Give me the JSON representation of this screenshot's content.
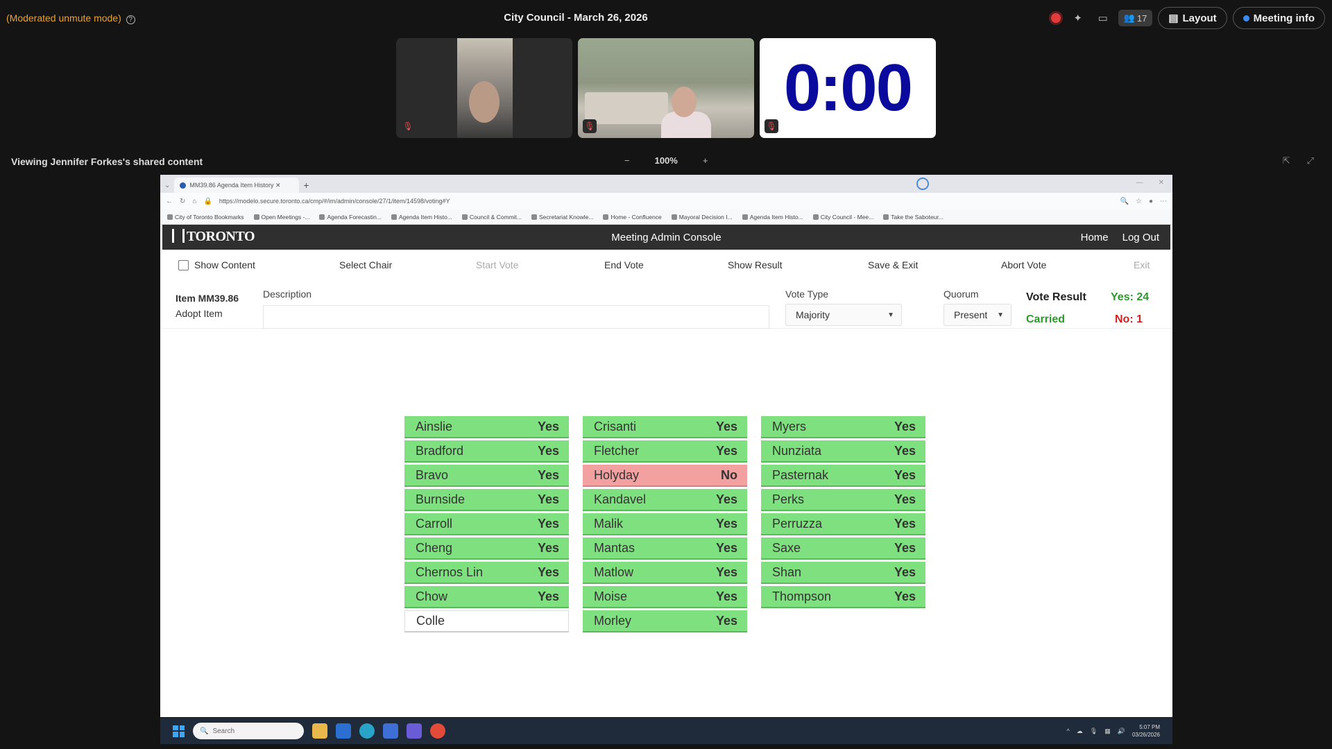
{
  "topbar": {
    "mode_label": "(Moderated unmute mode)",
    "help_glyph": "?",
    "meeting_title": "City Council - March 26, 2026",
    "participant_count": "17",
    "layout_label": "Layout",
    "meeting_info_label": "Meeting info"
  },
  "timer": {
    "value": "0:00"
  },
  "share": {
    "viewing_label": "Viewing Jennifer Forkes's shared content",
    "zoom_out": "−",
    "zoom_level": "100%",
    "zoom_in": "+"
  },
  "browser": {
    "tab_title": "MM39.86 Agenda Item History ✕",
    "url": "https://modelo.secure.toronto.ca/cmp/#/im/admin/console/27/1/item/14598/voting#Y",
    "bookmarks": [
      "City of Toronto Bookmarks",
      "Open Meetings -...",
      "Agenda Forecastin...",
      "Agenda Item Histo...",
      "Council & Commit...",
      "Secretariat Knowle...",
      "Home - Confluence",
      "Mayoral Decision I...",
      "Agenda Item Histo...",
      "City Council - Mee...",
      "Take the Saboteur..."
    ]
  },
  "app": {
    "logo_text": "TORONTO",
    "title": "Meeting Admin Console",
    "nav_home": "Home",
    "nav_logout": "Log Out"
  },
  "actions": {
    "show_content": "Show Content",
    "select_chair": "Select Chair",
    "start_vote": "Start Vote",
    "end_vote": "End Vote",
    "show_result": "Show Result",
    "save_exit": "Save & Exit",
    "abort_vote": "Abort Vote",
    "exit": "Exit"
  },
  "item": {
    "id": "Item MM39.86",
    "name": "Adopt Item",
    "description_label": "Description",
    "description_value": "",
    "vote_type_label": "Vote Type",
    "vote_type_value": "Majority",
    "quorum_label": "Quorum",
    "quorum_value": "Present",
    "result_label": "Vote Result",
    "result_status": "Carried",
    "yes_count": "Yes: 24",
    "no_count": "No: 1"
  },
  "votes": {
    "columns": [
      [
        {
          "name": "Ainslie",
          "vote": "Yes"
        },
        {
          "name": "Bradford",
          "vote": "Yes"
        },
        {
          "name": "Bravo",
          "vote": "Yes"
        },
        {
          "name": "Burnside",
          "vote": "Yes"
        },
        {
          "name": "Carroll",
          "vote": "Yes"
        },
        {
          "name": "Cheng",
          "vote": "Yes"
        },
        {
          "name": "Chernos Lin",
          "vote": "Yes"
        },
        {
          "name": "Chow",
          "vote": "Yes"
        },
        {
          "name": "Colle",
          "vote": ""
        }
      ],
      [
        {
          "name": "Crisanti",
          "vote": "Yes"
        },
        {
          "name": "Fletcher",
          "vote": "Yes"
        },
        {
          "name": "Holyday",
          "vote": "No"
        },
        {
          "name": "Kandavel",
          "vote": "Yes"
        },
        {
          "name": "Malik",
          "vote": "Yes"
        },
        {
          "name": "Mantas",
          "vote": "Yes"
        },
        {
          "name": "Matlow",
          "vote": "Yes"
        },
        {
          "name": "Moise",
          "vote": "Yes"
        },
        {
          "name": "Morley",
          "vote": "Yes"
        }
      ],
      [
        {
          "name": "Myers",
          "vote": "Yes"
        },
        {
          "name": "Nunziata",
          "vote": "Yes"
        },
        {
          "name": "Pasternak",
          "vote": "Yes"
        },
        {
          "name": "Perks",
          "vote": "Yes"
        },
        {
          "name": "Perruzza",
          "vote": "Yes"
        },
        {
          "name": "Saxe",
          "vote": "Yes"
        },
        {
          "name": "Shan",
          "vote": "Yes"
        },
        {
          "name": "Thompson",
          "vote": "Yes"
        }
      ]
    ]
  },
  "taskbar": {
    "search_placeholder": "Search",
    "time": "5:07 PM",
    "date": "03/26/2026"
  },
  "colors": {
    "yes_bg": "#7fe07f",
    "no_bg": "#f2a0a0",
    "carried": "#2b9a2b",
    "no_text": "#d42020",
    "timer": "#0a0a9c"
  }
}
